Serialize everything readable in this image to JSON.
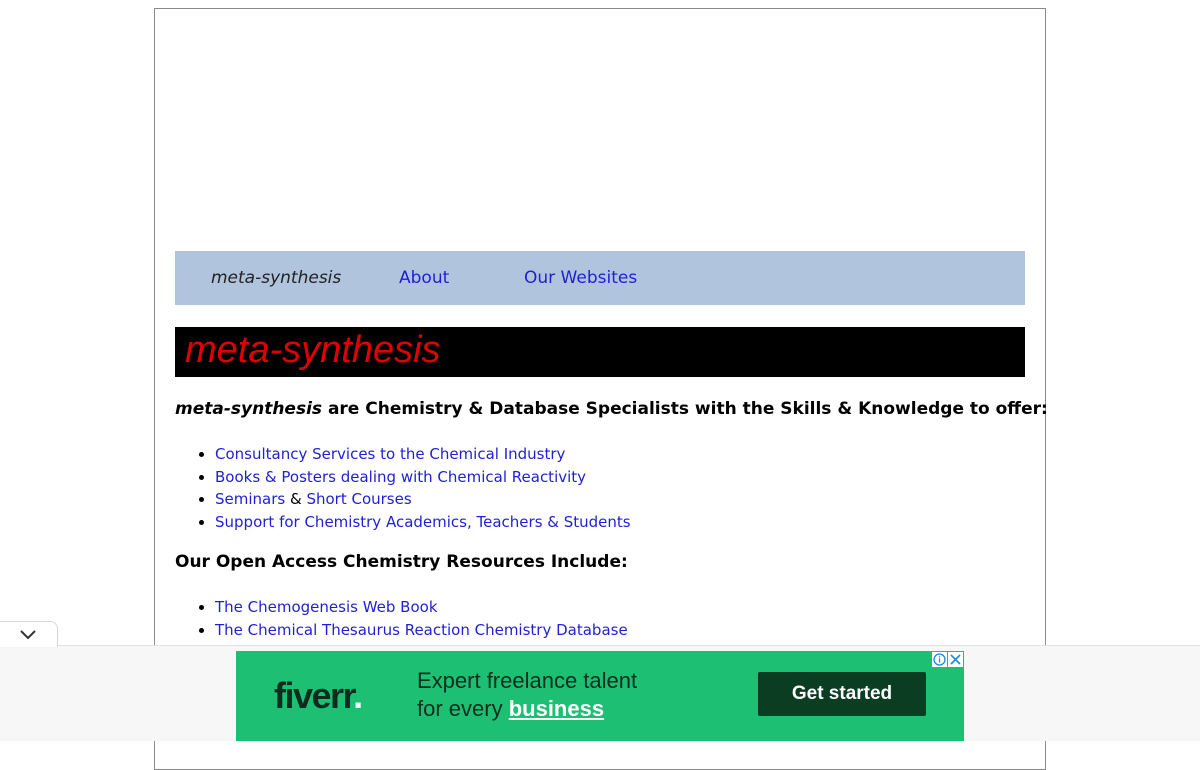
{
  "nav": {
    "brand": "meta-synthesis",
    "about": "About",
    "our_websites": "Our Websites"
  },
  "banner": {
    "title": "meta-synthesis"
  },
  "intro": {
    "brand": "meta-synthesis",
    "text": " are Chemistry & Database Specialists with the Skills & Knowledge to offer:"
  },
  "offers": [
    {
      "label": "Consultancy Services to the Chemical Industry"
    },
    {
      "label": "Books & Posters dealing with Chemical Reactivity"
    },
    {
      "label_a": "Seminars",
      "sep": " & ",
      "label_b": "Short Courses"
    },
    {
      "label": "Support for Chemistry Academics, Teachers & Students"
    }
  ],
  "resources_heading": "Our Open Access Chemistry Resources Include:",
  "resources": [
    {
      "label": "The Chemogenesis Web Book"
    },
    {
      "label": "The Chemical Thesaurus Reaction Chemistry Database"
    }
  ],
  "ad": {
    "logo": "fiverr",
    "logo_dot": ".",
    "line1": "Expert freelance talent",
    "line2_prefix": "for every ",
    "line2_highlight": "business",
    "cta": "Get started",
    "info_icon": "info-icon",
    "close_icon": "close-icon",
    "colors": {
      "background": "#1dbf73",
      "button": "#0b3d22",
      "text": "#0b2d1d"
    }
  },
  "colors": {
    "nav_background": "#b0c4de",
    "link": "#1f1fd6",
    "banner_background": "#000000",
    "banner_text": "#e00000"
  }
}
